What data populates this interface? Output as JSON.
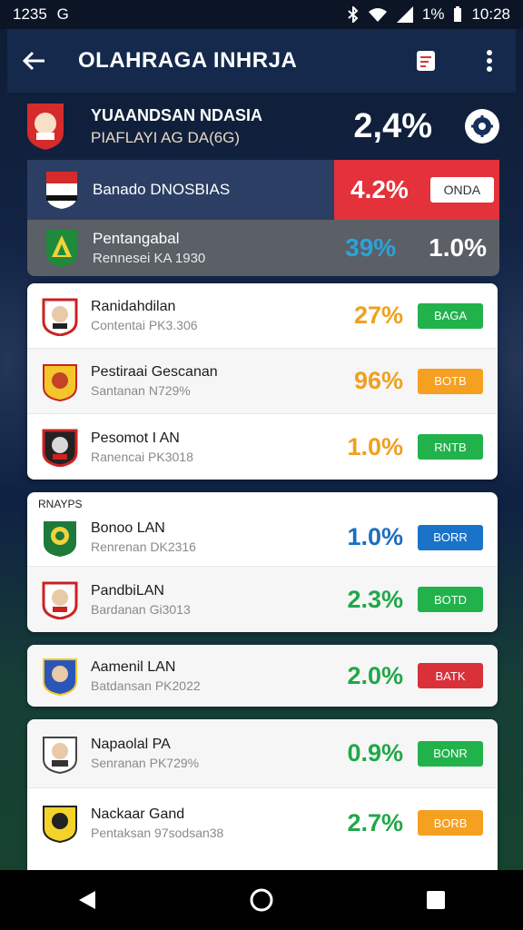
{
  "status_bar": {
    "time_left": "1235",
    "left_icon": "G",
    "battery": "1%",
    "time_right": "10:28"
  },
  "app_bar": {
    "title": "OLAHRAGA INHRJA"
  },
  "summary": {
    "title": "YUAANDSAN NDASIA",
    "subtitle": "PIAFLAYI AG DA(6G)",
    "percentage": "2,4%",
    "action_icon": "settings-badge-icon"
  },
  "featured": [
    {
      "name": "Banado DNOSBIAS",
      "value": "4.2%",
      "button": "ONDA"
    },
    {
      "name": "Pentangabal",
      "sub": "Rennesei KA 1930",
      "value": "39%",
      "value2": "1.0%"
    }
  ],
  "group1": [
    {
      "name": "Ranidahdilan",
      "sub": "Contentai PK3.306",
      "value": "27%",
      "value_color": "#f0a020",
      "button": "BAGA",
      "button_color": "#22b24c"
    },
    {
      "name": "Pestiraai Gescanan",
      "sub": "Santanan N729%",
      "value": "96%",
      "value_color": "#f0a020",
      "button": "BOTB",
      "button_color": "#f5a020"
    },
    {
      "name": "Pesomot I AN",
      "sub": "Ranencai PK3018",
      "value": "1.0%",
      "value_color": "#f0a020",
      "button": "RNTB",
      "button_color": "#22b24c"
    }
  ],
  "group2": {
    "label": "RNAYPS",
    "rows": [
      {
        "name": "Bonoo LAN",
        "sub": "Renrenan DK2316",
        "value": "1.0%",
        "value_color": "#1d6fc0",
        "button": "BORR",
        "button_color": "#1a73c8"
      },
      {
        "name": "PandbiLAN",
        "sub": "Bardanan Gi3013",
        "value": "2.3%",
        "value_color": "#20a848",
        "button": "BOTD",
        "button_color": "#22b24c"
      }
    ]
  },
  "group3": [
    {
      "name": "Aamenil LAN",
      "sub": "Batdansan PK2022",
      "value": "2.0%",
      "value_color": "#20a848",
      "button": "BATK",
      "button_color": "#d9303a"
    }
  ],
  "group4": [
    {
      "name": "Napaolal PA",
      "sub": "Senranan PK729%",
      "value": "0.9%",
      "value_color": "#20a848",
      "button": "BONR",
      "button_color": "#22b24c"
    },
    {
      "name": "Nackaar Gand",
      "sub": "Pentaksan 97sodsan38",
      "value": "2.7%",
      "value_color": "#20a848",
      "button": "BORB",
      "button_color": "#f5a020"
    }
  ],
  "nav": {
    "back": "back-icon",
    "home": "home-icon",
    "recents": "recents-icon"
  }
}
